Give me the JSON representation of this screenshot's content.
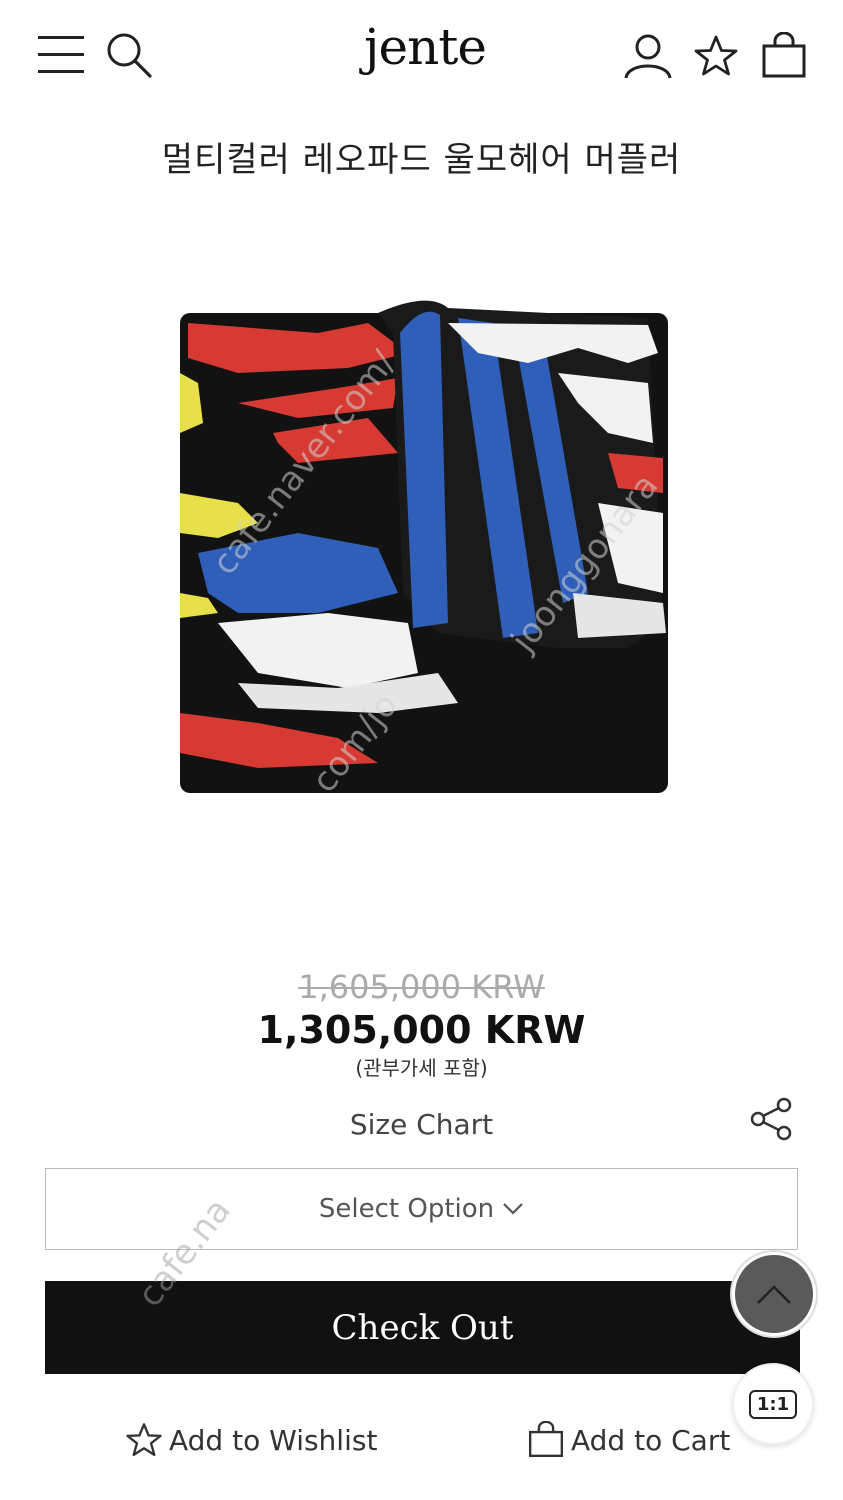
{
  "header": {
    "logo": "jente",
    "icons": [
      "menu-icon",
      "search-icon",
      "account-icon",
      "star-icon",
      "shopping-bag-icon"
    ]
  },
  "product": {
    "title": "멀티컬러 레오파드 울모헤어 머플러",
    "original_price": "1,605,000 KRW",
    "sale_price": "1,305,000 KRW",
    "tax_note": "(관부가세 포함)",
    "image_colors": [
      "#111111",
      "#d63a33",
      "#2f5fb8",
      "#e8e04a",
      "#f2f2f2"
    ]
  },
  "watermark": {
    "line1": "cafe.naver.com/",
    "line2": "joonggonara",
    "line3": "com/jo",
    "cafe": "cafe.na"
  },
  "actions": {
    "size_chart": "Size Chart",
    "select_option": "Select Option",
    "checkout": "Check Out",
    "add_to_wishlist": "Add to Wishlist",
    "add_to_cart": "Add to Cart",
    "chat_label": "1:1"
  }
}
